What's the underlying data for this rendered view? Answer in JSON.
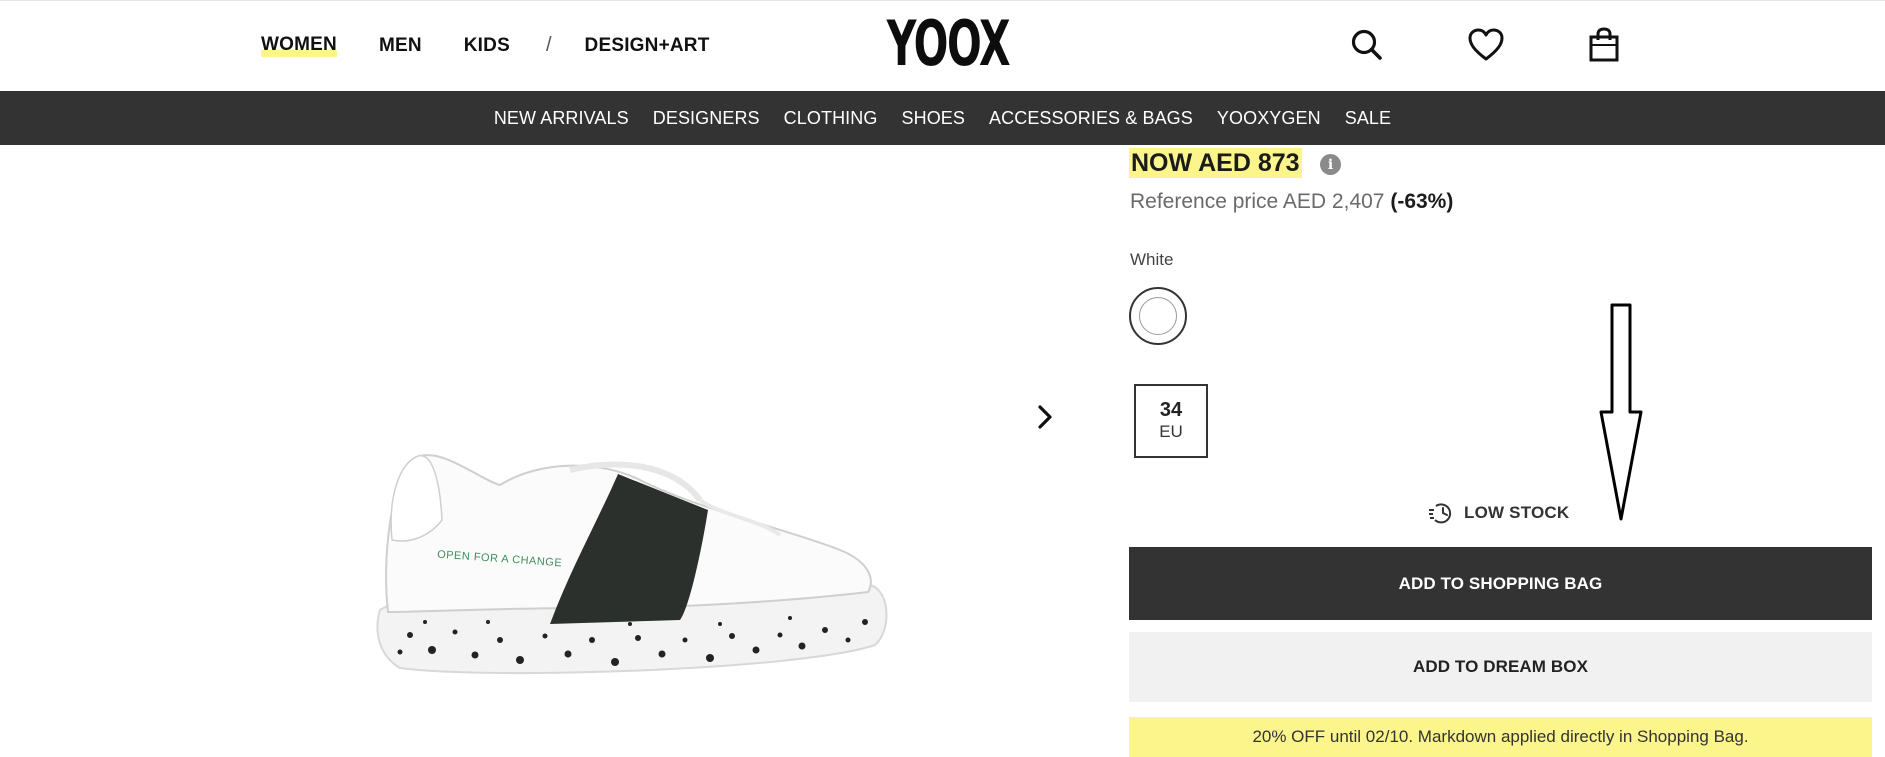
{
  "header": {
    "gender_nav": [
      "WOMEN",
      "MEN",
      "KIDS"
    ],
    "separator": "/",
    "extra_nav": "DESIGN+ART",
    "active_item": "WOMEN",
    "logo": "YOOX",
    "icons": [
      "search-icon",
      "heart-icon",
      "shopping-bag-icon"
    ]
  },
  "categories": [
    "NEW ARRIVALS",
    "DESIGNERS",
    "CLOTHING",
    "SHOES",
    "ACCESSORIES & BAGS",
    "YOOXYGEN",
    "SALE"
  ],
  "product": {
    "price_now": "NOW AED 873",
    "reference_label": "Reference price AED 2,407",
    "discount": "(-63%)",
    "color_label": "White",
    "size": {
      "value": "34",
      "unit": "EU"
    },
    "stock": "LOW STOCK",
    "image_text": "OPEN FOR A CHANGE"
  },
  "actions": {
    "add_to_bag": "ADD TO SHOPPING BAG",
    "add_to_dream_box": "ADD TO DREAM BOX"
  },
  "promo": "20% OFF until 02/10. Markdown applied directly in Shopping Bag.",
  "colors": {
    "dark_bar": "#333333",
    "highlight": "#fbf58b",
    "button_light": "#f1f1f1"
  }
}
